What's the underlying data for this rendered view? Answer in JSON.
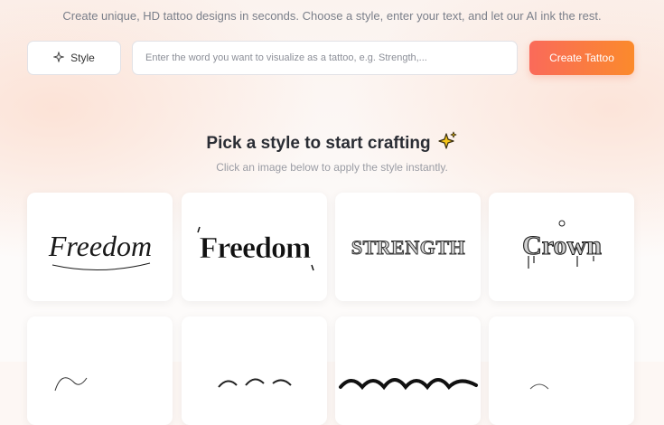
{
  "subtitle": "Create unique, HD tattoo designs in seconds. Choose a style, enter your text, and let our AI ink the rest.",
  "controls": {
    "style_label": "Style",
    "input_placeholder": "Enter the word you want to visualize as a tattoo, e.g. Strength,...",
    "input_value": "",
    "create_label": "Create Tattoo"
  },
  "section": {
    "title": "Pick a style to start crafting",
    "subtitle": "Click an image below to apply the style instantly."
  },
  "styles": [
    {
      "text": "Freedom"
    },
    {
      "text": "Freedom"
    },
    {
      "text": "STRENGTH"
    },
    {
      "text": "Crown"
    }
  ],
  "colors": {
    "accent_start": "#fa6a5a",
    "accent_end": "#fb8a2c",
    "sparkle": "#f5c518"
  }
}
